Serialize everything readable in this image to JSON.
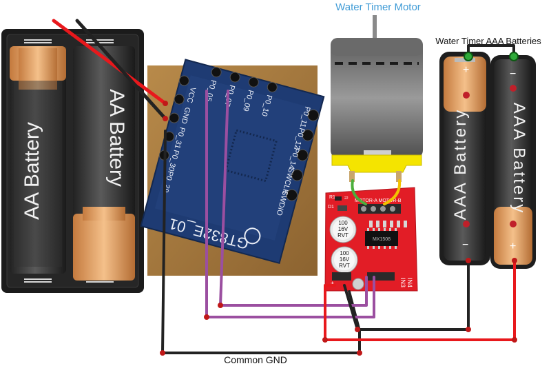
{
  "labels": {
    "motor_title": "Water Timer Motor",
    "aaa_title": "Water Timer AAA Batteries",
    "common_gnd": "Common GND"
  },
  "aa_pack": {
    "cells": [
      "AA Battery",
      "AA Battery"
    ]
  },
  "aaa_cells": [
    "AAA Battery",
    "AAA Battery"
  ],
  "aaa_polarity": {
    "left_top": "+",
    "left_bottom": "−",
    "right_top": "−",
    "right_bottom": "+"
  },
  "mcu_board": {
    "module_text": "GT832E_01",
    "pins_left": [
      "VCC",
      "GND",
      "P0_31",
      "P0_30",
      "P0_29"
    ],
    "pins_top": [
      "P0_05",
      "P0_07",
      "P0_09",
      "P0_10"
    ],
    "pins_right": [
      "P0_11",
      "P0_12",
      "P0_14",
      "SWCLK",
      "SWDIO"
    ]
  },
  "driver_board": {
    "header_text": "MOTOR-A MOTOR-B",
    "cap1": [
      "100",
      "16V",
      "RVT"
    ],
    "cap2": [
      "100",
      "16V",
      "RVT"
    ],
    "ic_text": "MX1508",
    "inputs": [
      "IN3",
      "IN4"
    ],
    "d1": "D1",
    "r1": "R1",
    "r2": "22"
  },
  "colors": {
    "red_wire": "#e8181c",
    "black_wire": "#222222",
    "purple_wire": "#9b4fa0",
    "green_wire": "#4caf3c",
    "yellow_wire": "#f2c200",
    "motor_title_color": "#3f9bd6",
    "pcb_red": "#e21d26",
    "mcu_blue": "#1e3b73"
  }
}
